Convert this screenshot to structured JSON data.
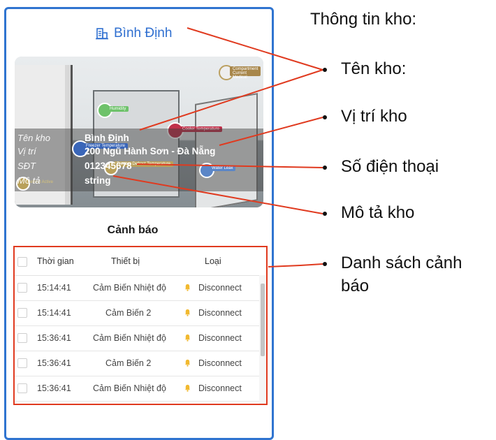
{
  "header": {
    "title": "Bình Định"
  },
  "photo": {
    "labels": {
      "compartment": "Compartment Current Medical",
      "humidity": "Humidity",
      "cooler": "Cooler Temperature",
      "freezer": "Freezer Temperature",
      "freezer2": "Freezer Defrost Temperature",
      "water": "Water Leak",
      "defrost": "Defrost Active"
    }
  },
  "info": [
    {
      "key": "Tên kho",
      "value": "Bình Định"
    },
    {
      "key": "Vị trí",
      "value": "200 Ngũ Hành Sơn - Đà Nẵng"
    },
    {
      "key": "SĐT",
      "value": "012345678"
    },
    {
      "key": "Mô tả",
      "value": "string"
    }
  ],
  "alerts": {
    "title": "Cảnh báo",
    "columns": [
      "Thời gian",
      "Thiết bị",
      "Loại"
    ],
    "rows": [
      {
        "time": "15:14:41",
        "device": "Cảm Biến Nhiệt độ",
        "type": "Disconnect"
      },
      {
        "time": "15:14:41",
        "device": "Cảm Biến 2",
        "type": "Disconnect"
      },
      {
        "time": "15:36:41",
        "device": "Cảm Biến Nhiệt độ",
        "type": "Disconnect"
      },
      {
        "time": "15:36:41",
        "device": "Cảm Biến 2",
        "type": "Disconnect"
      },
      {
        "time": "15:36:41",
        "device": "Cảm Biến Nhiệt độ",
        "type": "Disconnect"
      }
    ]
  },
  "annotations": {
    "heading": "Thông tin kho:",
    "items": [
      "Tên kho:",
      "Vị trí kho",
      "Số điện thoại",
      "Mô tả kho",
      "Danh sách cảnh",
      "báo"
    ]
  },
  "colors": {
    "accent": "#2f74d0",
    "annotation_line": "#e03a1f"
  }
}
